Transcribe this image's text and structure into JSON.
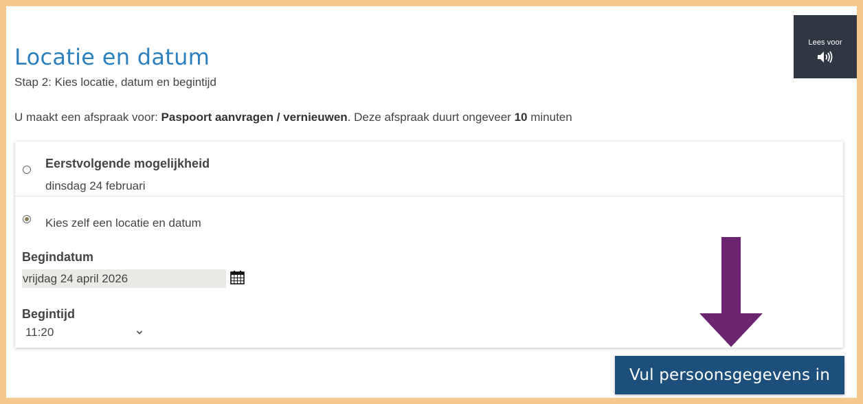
{
  "read_aloud": {
    "label": "Lees voor",
    "icon": "speaker-icon"
  },
  "header": {
    "title": "Locatie en datum",
    "step": "Stap 2: Kies locatie, datum en begintijd"
  },
  "intro": {
    "prefix": "U maakt een afspraak voor: ",
    "product": "Paspoort aanvragen / vernieuwen",
    "middle": ". Deze afspraak duurt ongeveer ",
    "duration": "10",
    "suffix": " minuten"
  },
  "options": {
    "first_title": "Eerstvolgende mogelijkheid",
    "first_date": "dinsdag 24 februari",
    "first_selected": false,
    "self_label": "Kies zelf een locatie en datum",
    "self_selected": true
  },
  "form": {
    "start_date_label": "Begindatum",
    "start_date_value": "vrijdag 24 april 2026",
    "start_time_label": "Begintijd",
    "start_time_value": "11:20"
  },
  "next_button": {
    "label": "Vul persoonsgegevens in"
  },
  "colors": {
    "page_border": "#f5c98e",
    "title": "#2b80bd",
    "read_aloud_bg": "#2f3743",
    "button_bg": "#1d4f7c",
    "arrow": "#6b2470"
  }
}
